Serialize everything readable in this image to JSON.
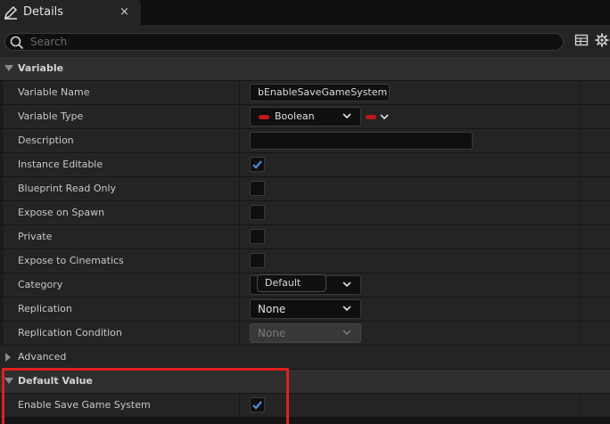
{
  "tab": {
    "title": "Details",
    "close": "×"
  },
  "search": {
    "placeholder": "Search"
  },
  "sections": {
    "variable": "Variable",
    "default_value": "Default Value"
  },
  "rows": {
    "variable_name": {
      "label": "Variable Name",
      "value": "bEnableSaveGameSystem"
    },
    "variable_type": {
      "label": "Variable Type",
      "value": "Boolean"
    },
    "description": {
      "label": "Description",
      "value": ""
    },
    "instance_editable": {
      "label": "Instance Editable",
      "checked": true
    },
    "blueprint_read_only": {
      "label": "Blueprint Read Only",
      "checked": false
    },
    "expose_on_spawn": {
      "label": "Expose on Spawn",
      "checked": false
    },
    "private": {
      "label": "Private",
      "checked": false
    },
    "expose_to_cinematics": {
      "label": "Expose to Cinematics",
      "checked": false
    },
    "category": {
      "label": "Category",
      "value": "Default"
    },
    "replication": {
      "label": "Replication",
      "value": "None"
    },
    "replication_condition": {
      "label": "Replication Condition",
      "value": "None"
    },
    "advanced": {
      "label": "Advanced"
    },
    "enable_save_game_system": {
      "label": "Enable Save Game System",
      "checked": true
    }
  },
  "colors": {
    "accent": "#4d8fd9",
    "boolean_pin": "#c01818",
    "highlight": "#e02020"
  },
  "icons": [
    "pencil-icon",
    "close-icon",
    "search-icon",
    "table-view-icon",
    "settings-gear-icon",
    "chevron-down-icon",
    "check-icon"
  ]
}
